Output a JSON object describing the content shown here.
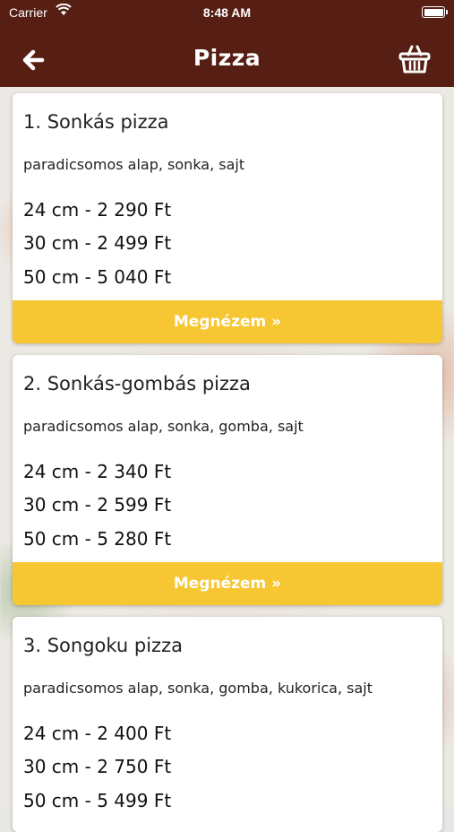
{
  "status_bar": {
    "carrier": "Carrier",
    "time": "8:48 AM"
  },
  "header": {
    "title": "Pizza",
    "back_icon": "arrow-left-icon",
    "cart_icon": "basket-icon"
  },
  "accent_colors": {
    "header": "#571f14",
    "button": "#f6c733"
  },
  "items": [
    {
      "name": "1. Sonkás pizza",
      "description": "paradicsomos alap, sonka, sajt",
      "prices": [
        "24 cm - 2 290 Ft",
        "30 cm - 2 499 Ft",
        "50 cm - 5 040 Ft"
      ],
      "button": "Megnézem »"
    },
    {
      "name": "2. Sonkás-gombás pizza",
      "description": "paradicsomos alap, sonka, gomba, sajt",
      "prices": [
        "24 cm - 2 340 Ft",
        "30 cm - 2 599 Ft",
        "50 cm - 5 280 Ft"
      ],
      "button": "Megnézem »"
    },
    {
      "name": "3. Songoku pizza",
      "description": "paradicsomos alap, sonka, gomba, kukorica, sajt",
      "prices": [
        "24 cm - 2 400 Ft",
        "30 cm - 2 750 Ft",
        "50 cm - 5 499 Ft"
      ],
      "button": ""
    }
  ]
}
